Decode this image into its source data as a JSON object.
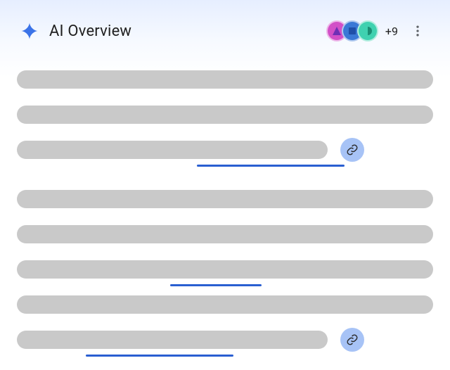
{
  "header": {
    "title": "AI Overview",
    "overflow_count": "+9"
  },
  "avatars": {
    "a1": {
      "color": "#d24fc7",
      "shape": "triangle"
    },
    "a2": {
      "color": "#3a78d6",
      "shape": "square"
    },
    "a3": {
      "color": "#3fd1b0",
      "shape": "half-circle"
    }
  },
  "placeholder_bar_color": "#c9c9c9",
  "link_underline_color": "#2a5fd1",
  "link_chip_color": "#a7c3f6"
}
